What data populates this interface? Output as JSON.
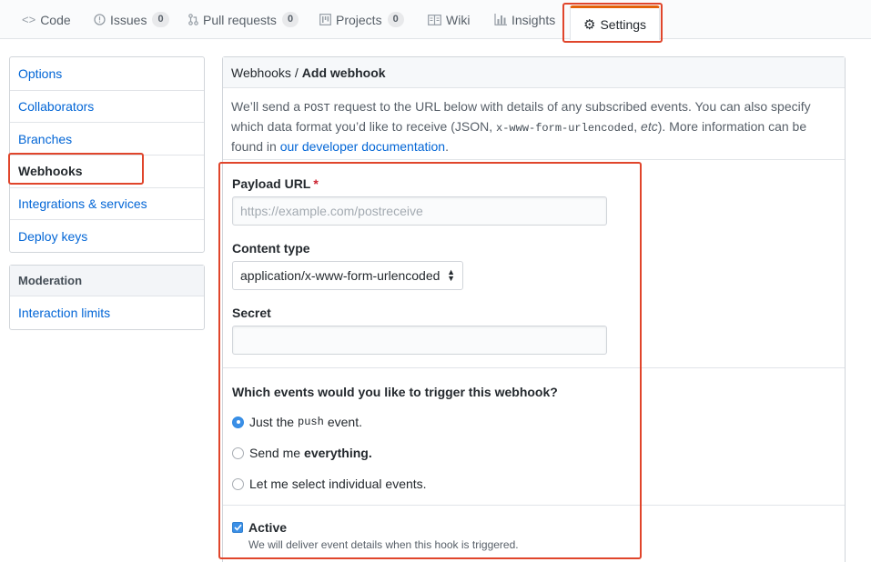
{
  "tabs": [
    {
      "label": "Code",
      "icon": "code-icon"
    },
    {
      "label": "Issues",
      "icon": "issue-icon",
      "count": "0"
    },
    {
      "label": "Pull requests",
      "icon": "pull-request-icon",
      "count": "0"
    },
    {
      "label": "Projects",
      "icon": "project-icon",
      "count": "0"
    },
    {
      "label": "Wiki",
      "icon": "book-icon"
    },
    {
      "label": "Insights",
      "icon": "graph-icon"
    },
    {
      "label": "Settings",
      "icon": "gear-icon",
      "selected": true
    }
  ],
  "sidebar": {
    "items": [
      {
        "label": "Options"
      },
      {
        "label": "Collaborators"
      },
      {
        "label": "Branches"
      },
      {
        "label": "Webhooks",
        "selected": true
      },
      {
        "label": "Integrations & services"
      },
      {
        "label": "Deploy keys"
      }
    ],
    "moderation": {
      "heading": "Moderation",
      "items": [
        {
          "label": "Interaction limits"
        }
      ]
    }
  },
  "main": {
    "breadcrumb": {
      "parent": "Webhooks",
      "separator": "/",
      "current": "Add webhook"
    },
    "intro": {
      "text1": "We’ll send a",
      "code1": "POST",
      "text2": "request to the URL below with details of any subscribed events. You can also specify which data format you’d like to receive (JSON,",
      "code2": "x-www-form-urlencoded",
      "text3": ",",
      "text3_em": "etc",
      "text4": "). More information can be found in",
      "link": "our developer documentation",
      "text5": "."
    },
    "form": {
      "payload_label": "Payload URL",
      "required_mark": "*",
      "payload_placeholder": "https://example.com/postreceive",
      "payload_value": "",
      "content_type_label": "Content type",
      "content_type_value": "application/x-www-form-urlencoded",
      "secret_label": "Secret",
      "secret_value": "",
      "events_question": "Which events would you like to trigger this webhook?",
      "events": {
        "push": {
          "prefix": "Just the",
          "code": "push",
          "suffix": "event.",
          "checked": true
        },
        "everything": {
          "prefix": "Send me",
          "bold": "everything.",
          "checked": false
        },
        "individual": {
          "label": "Let me select individual events.",
          "checked": false
        }
      },
      "active_label": "Active",
      "active_checked": true,
      "active_note": "We will deliver event details when this hook is triggered."
    }
  },
  "colors": {
    "link": "#0366d6",
    "highlight": "#e0452b",
    "tab_accent": "#e36209",
    "checked": "#3b8fe6"
  }
}
